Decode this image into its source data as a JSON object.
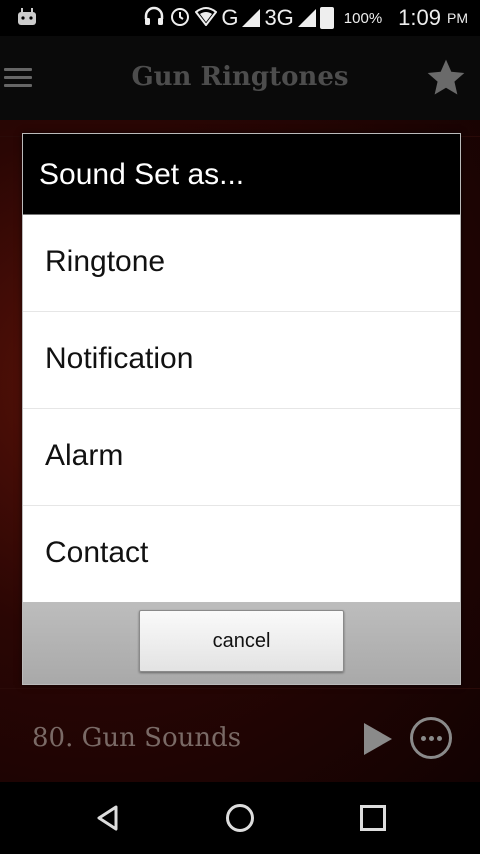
{
  "status_bar": {
    "network1": "G",
    "network2": "3G",
    "battery": "100%",
    "time": "1:09",
    "ampm": "PM"
  },
  "app_bar": {
    "title": "Gun Ringtones"
  },
  "list": {
    "items": [
      {
        "label": ""
      },
      {
        "label": "80. Gun Sounds"
      }
    ]
  },
  "dialog": {
    "title": "Sound Set as...",
    "options": [
      {
        "label": "Ringtone"
      },
      {
        "label": "Notification"
      },
      {
        "label": "Alarm"
      },
      {
        "label": "Contact"
      }
    ],
    "cancel_label": "cancel"
  },
  "colors": {
    "background_red": "#5a1208",
    "dialog_header": "#000000",
    "dialog_body": "#ffffff"
  }
}
